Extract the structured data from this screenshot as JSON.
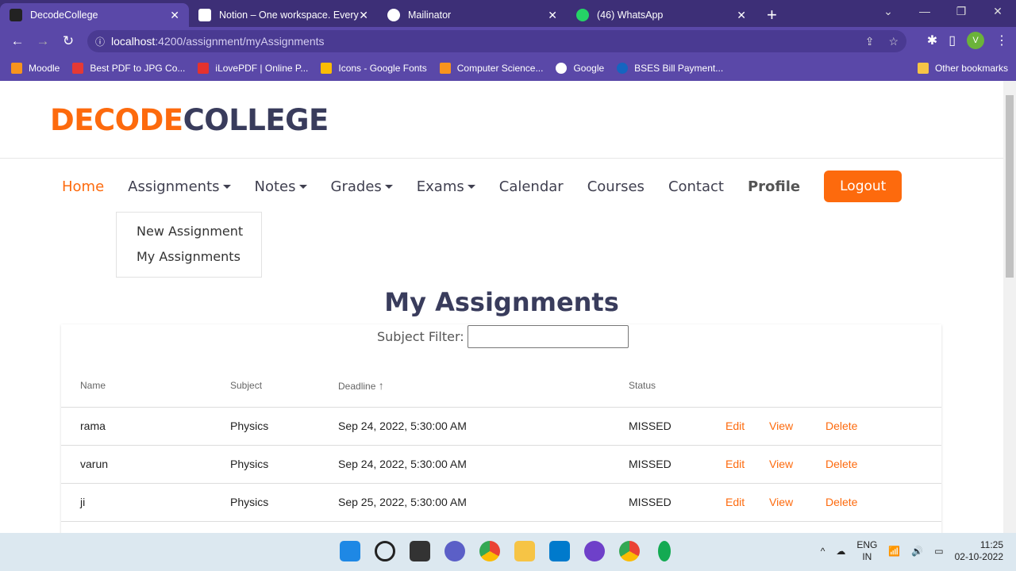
{
  "browser": {
    "tabs": [
      {
        "title": "DecodeCollege",
        "active": true,
        "icon": "decodecollege-favicon"
      },
      {
        "title": "Notion – One workspace. Every t",
        "active": false,
        "icon": "notion-icon"
      },
      {
        "title": "Mailinator",
        "active": false,
        "icon": "globe-icon"
      },
      {
        "title": "(46) WhatsApp",
        "active": false,
        "icon": "whatsapp-icon"
      }
    ],
    "url_host": "localhost",
    "url_path": ":4200/assignment/myAssignments",
    "profile_initial": "V",
    "bookmarks": [
      "Moodle",
      "Best PDF to JPG Co...",
      "iLovePDF | Online P...",
      "Icons - Google Fonts",
      "Computer Science...",
      "Google",
      "BSES Bill Payment..."
    ],
    "other_bookmarks": "Other bookmarks"
  },
  "site": {
    "logo_a": "DECODE",
    "logo_b": "COLLEGE",
    "nav": {
      "home": "Home",
      "assignments": "Assignments",
      "notes": "Notes",
      "grades": "Grades",
      "exams": "Exams",
      "calendar": "Calendar",
      "courses": "Courses",
      "contact": "Contact",
      "profile": "Profile",
      "logout": "Logout"
    },
    "dropdown": [
      "New Assignment",
      "My Assignments"
    ],
    "title": "My Assignments",
    "filter_label": "Subject Filter:",
    "filter_value": "",
    "columns": [
      "Name",
      "Subject",
      "Deadline",
      "Status"
    ],
    "sort_icon": "arrow-up-icon",
    "rows": [
      {
        "name": "rama",
        "subject": "Physics",
        "deadline": "Sep 24, 2022, 5:30:00 AM",
        "status": "MISSED"
      },
      {
        "name": "varun",
        "subject": "Physics",
        "deadline": "Sep 24, 2022, 5:30:00 AM",
        "status": "MISSED"
      },
      {
        "name": "ji",
        "subject": "Physics",
        "deadline": "Sep 25, 2022, 5:30:00 AM",
        "status": "MISSED"
      }
    ],
    "actions": {
      "edit": "Edit",
      "view": "View",
      "delete": "Delete"
    },
    "accent": "#fd6a0d",
    "navy": "#393c5c"
  },
  "taskbar": {
    "lang1": "ENG",
    "lang2": "IN",
    "time": "11:25",
    "date": "02-10-2022"
  }
}
